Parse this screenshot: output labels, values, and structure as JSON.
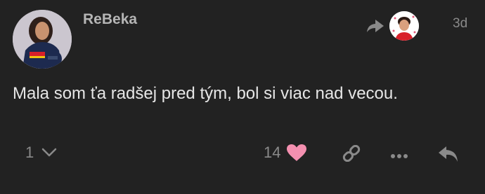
{
  "post": {
    "username": "ReBeka",
    "date": "3d",
    "body": "Mala som ťa radšej pred tým, bol si viac nad vecou.",
    "replies_count": "1",
    "likes_count": "14",
    "heart_color": "#f490b0"
  },
  "icons": {
    "reply_to": "reply-arrow-icon",
    "expand": "chevron-down-icon",
    "like": "heart-icon",
    "link": "link-icon",
    "more": "ellipsis-icon",
    "reply": "reply-icon"
  }
}
